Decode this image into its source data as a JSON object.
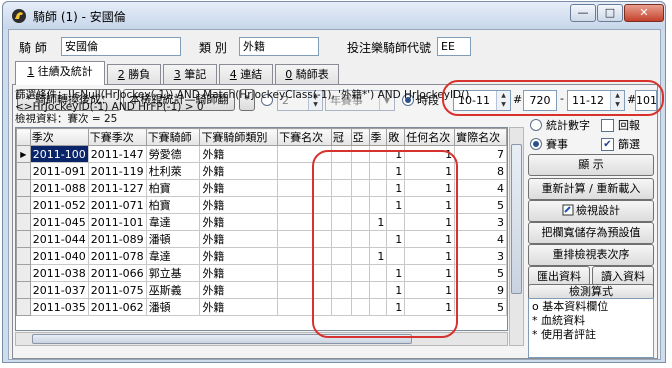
{
  "window": {
    "title": "騎師 (1) - 安國倫",
    "buttons": {
      "minimize": "—",
      "maximize": "□",
      "close": "✕"
    }
  },
  "header": {
    "jockey_label": "騎 師",
    "jockey_value": "安國倫",
    "category_label": "類 別",
    "category_value": "外籍",
    "code_label": "投注樂騎師代號",
    "code_value": "EE"
  },
  "tabs": [
    {
      "num": "1",
      "label": "往績及統計"
    },
    {
      "num": "2",
      "label": "勝負"
    },
    {
      "num": "3",
      "label": "筆記"
    },
    {
      "num": "4",
      "label": "連結"
    },
    {
      "num": "0",
      "label": "騎師表"
    }
  ],
  "toolbar": {
    "convert_button": "* 騎師轉換後成：",
    "view_button": "本檢視統計—騎師翻",
    "star_button": "*",
    "count_value": "2",
    "season_select": "年賽事",
    "period_label": "時段",
    "range1_from": "10-11",
    "sep1": "#",
    "range1_num": "720",
    "range2_dash": "-",
    "range2_from": "11-12",
    "sep2": "#",
    "range2_num": "101"
  },
  "filter": {
    "text": "篩選條件：!IsNull(HrJockey(-1)) AND Match(HrJockeyClass(-1), '外籍*') AND HrJockeyID()<>HrJockeyID(-1) AND HrFP(-1) > 0",
    "line3": "檢視資料：賽次 = 25"
  },
  "grid": {
    "columns": [
      "季次",
      "下賽季次",
      "下賽騎師",
      "下賽騎師類別",
      "下賽名次",
      "冠",
      "亞",
      "季",
      "敗",
      "任何名次",
      "實際名次"
    ],
    "rows": [
      [
        "2011-100",
        "2011-147",
        "勞愛德",
        "外籍",
        "",
        "",
        "",
        "",
        "1",
        "1",
        "7"
      ],
      [
        "2011-091",
        "2011-119",
        "杜利萊",
        "外籍",
        "",
        "",
        "",
        "",
        "1",
        "1",
        "8"
      ],
      [
        "2011-088",
        "2011-127",
        "柏寶",
        "外籍",
        "",
        "",
        "",
        "",
        "1",
        "1",
        "4"
      ],
      [
        "2011-052",
        "2011-071",
        "柏寶",
        "外籍",
        "",
        "",
        "",
        "",
        "1",
        "1",
        "5"
      ],
      [
        "2011-045",
        "2011-101",
        "韋達",
        "外籍",
        "",
        "",
        "",
        "1",
        "",
        "1",
        "3"
      ],
      [
        "2011-044",
        "2011-089",
        "潘頓",
        "外籍",
        "",
        "",
        "",
        "",
        "1",
        "1",
        "4"
      ],
      [
        "2011-040",
        "2011-078",
        "韋達",
        "外籍",
        "",
        "",
        "",
        "1",
        "",
        "1",
        "3"
      ],
      [
        "2011-038",
        "2011-066",
        "郭立基",
        "外籍",
        "",
        "",
        "",
        "",
        "1",
        "1",
        "5"
      ],
      [
        "2011-037",
        "2011-075",
        "巫斯義",
        "外籍",
        "",
        "",
        "",
        "",
        "1",
        "1",
        "9"
      ],
      [
        "2011-035",
        "2011-062",
        "潘頓",
        "外籍",
        "",
        "",
        "",
        "",
        "1",
        "1",
        "5"
      ]
    ]
  },
  "options": {
    "stat_numbers": "統計數字",
    "report": "回報",
    "races": "賽事",
    "filter": "篩選"
  },
  "side_buttons": {
    "display": "顯 示",
    "recalc": "重新計算 / 重新載入",
    "view_design": "檢視設計",
    "save_default": "把欄寬儲存為預設值",
    "rearrange": "重排檢視表次序",
    "export": "匯出資料",
    "import": "讀入資料",
    "check_formula": "檢測算式"
  },
  "memo": {
    "lines": [
      "o 基本資料欄位",
      "* 血統資料",
      "* 使用者評註"
    ]
  },
  "colors": {
    "highlight": "#d8322e",
    "selection": "#0a246a"
  }
}
